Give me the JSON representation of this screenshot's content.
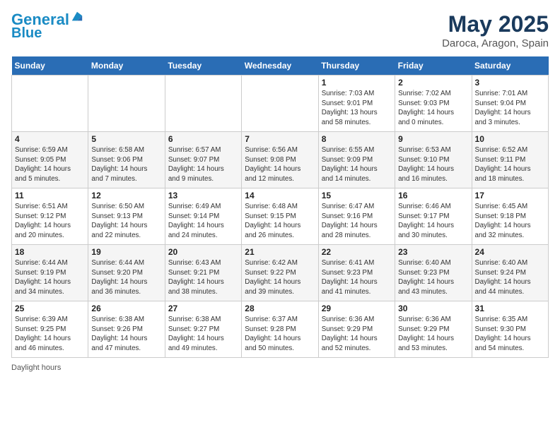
{
  "header": {
    "logo_line1": "General",
    "logo_line2": "Blue",
    "month": "May 2025",
    "location": "Daroca, Aragon, Spain"
  },
  "days_of_week": [
    "Sunday",
    "Monday",
    "Tuesday",
    "Wednesday",
    "Thursday",
    "Friday",
    "Saturday"
  ],
  "weeks": [
    [
      {
        "day": "",
        "info": ""
      },
      {
        "day": "",
        "info": ""
      },
      {
        "day": "",
        "info": ""
      },
      {
        "day": "",
        "info": ""
      },
      {
        "day": "1",
        "info": "Sunrise: 7:03 AM\nSunset: 9:01 PM\nDaylight: 13 hours\nand 58 minutes."
      },
      {
        "day": "2",
        "info": "Sunrise: 7:02 AM\nSunset: 9:03 PM\nDaylight: 14 hours\nand 0 minutes."
      },
      {
        "day": "3",
        "info": "Sunrise: 7:01 AM\nSunset: 9:04 PM\nDaylight: 14 hours\nand 3 minutes."
      }
    ],
    [
      {
        "day": "4",
        "info": "Sunrise: 6:59 AM\nSunset: 9:05 PM\nDaylight: 14 hours\nand 5 minutes."
      },
      {
        "day": "5",
        "info": "Sunrise: 6:58 AM\nSunset: 9:06 PM\nDaylight: 14 hours\nand 7 minutes."
      },
      {
        "day": "6",
        "info": "Sunrise: 6:57 AM\nSunset: 9:07 PM\nDaylight: 14 hours\nand 9 minutes."
      },
      {
        "day": "7",
        "info": "Sunrise: 6:56 AM\nSunset: 9:08 PM\nDaylight: 14 hours\nand 12 minutes."
      },
      {
        "day": "8",
        "info": "Sunrise: 6:55 AM\nSunset: 9:09 PM\nDaylight: 14 hours\nand 14 minutes."
      },
      {
        "day": "9",
        "info": "Sunrise: 6:53 AM\nSunset: 9:10 PM\nDaylight: 14 hours\nand 16 minutes."
      },
      {
        "day": "10",
        "info": "Sunrise: 6:52 AM\nSunset: 9:11 PM\nDaylight: 14 hours\nand 18 minutes."
      }
    ],
    [
      {
        "day": "11",
        "info": "Sunrise: 6:51 AM\nSunset: 9:12 PM\nDaylight: 14 hours\nand 20 minutes."
      },
      {
        "day": "12",
        "info": "Sunrise: 6:50 AM\nSunset: 9:13 PM\nDaylight: 14 hours\nand 22 minutes."
      },
      {
        "day": "13",
        "info": "Sunrise: 6:49 AM\nSunset: 9:14 PM\nDaylight: 14 hours\nand 24 minutes."
      },
      {
        "day": "14",
        "info": "Sunrise: 6:48 AM\nSunset: 9:15 PM\nDaylight: 14 hours\nand 26 minutes."
      },
      {
        "day": "15",
        "info": "Sunrise: 6:47 AM\nSunset: 9:16 PM\nDaylight: 14 hours\nand 28 minutes."
      },
      {
        "day": "16",
        "info": "Sunrise: 6:46 AM\nSunset: 9:17 PM\nDaylight: 14 hours\nand 30 minutes."
      },
      {
        "day": "17",
        "info": "Sunrise: 6:45 AM\nSunset: 9:18 PM\nDaylight: 14 hours\nand 32 minutes."
      }
    ],
    [
      {
        "day": "18",
        "info": "Sunrise: 6:44 AM\nSunset: 9:19 PM\nDaylight: 14 hours\nand 34 minutes."
      },
      {
        "day": "19",
        "info": "Sunrise: 6:44 AM\nSunset: 9:20 PM\nDaylight: 14 hours\nand 36 minutes."
      },
      {
        "day": "20",
        "info": "Sunrise: 6:43 AM\nSunset: 9:21 PM\nDaylight: 14 hours\nand 38 minutes."
      },
      {
        "day": "21",
        "info": "Sunrise: 6:42 AM\nSunset: 9:22 PM\nDaylight: 14 hours\nand 39 minutes."
      },
      {
        "day": "22",
        "info": "Sunrise: 6:41 AM\nSunset: 9:23 PM\nDaylight: 14 hours\nand 41 minutes."
      },
      {
        "day": "23",
        "info": "Sunrise: 6:40 AM\nSunset: 9:23 PM\nDaylight: 14 hours\nand 43 minutes."
      },
      {
        "day": "24",
        "info": "Sunrise: 6:40 AM\nSunset: 9:24 PM\nDaylight: 14 hours\nand 44 minutes."
      }
    ],
    [
      {
        "day": "25",
        "info": "Sunrise: 6:39 AM\nSunset: 9:25 PM\nDaylight: 14 hours\nand 46 minutes."
      },
      {
        "day": "26",
        "info": "Sunrise: 6:38 AM\nSunset: 9:26 PM\nDaylight: 14 hours\nand 47 minutes."
      },
      {
        "day": "27",
        "info": "Sunrise: 6:38 AM\nSunset: 9:27 PM\nDaylight: 14 hours\nand 49 minutes."
      },
      {
        "day": "28",
        "info": "Sunrise: 6:37 AM\nSunset: 9:28 PM\nDaylight: 14 hours\nand 50 minutes."
      },
      {
        "day": "29",
        "info": "Sunrise: 6:36 AM\nSunset: 9:29 PM\nDaylight: 14 hours\nand 52 minutes."
      },
      {
        "day": "30",
        "info": "Sunrise: 6:36 AM\nSunset: 9:29 PM\nDaylight: 14 hours\nand 53 minutes."
      },
      {
        "day": "31",
        "info": "Sunrise: 6:35 AM\nSunset: 9:30 PM\nDaylight: 14 hours\nand 54 minutes."
      }
    ]
  ],
  "footer": "Daylight hours"
}
